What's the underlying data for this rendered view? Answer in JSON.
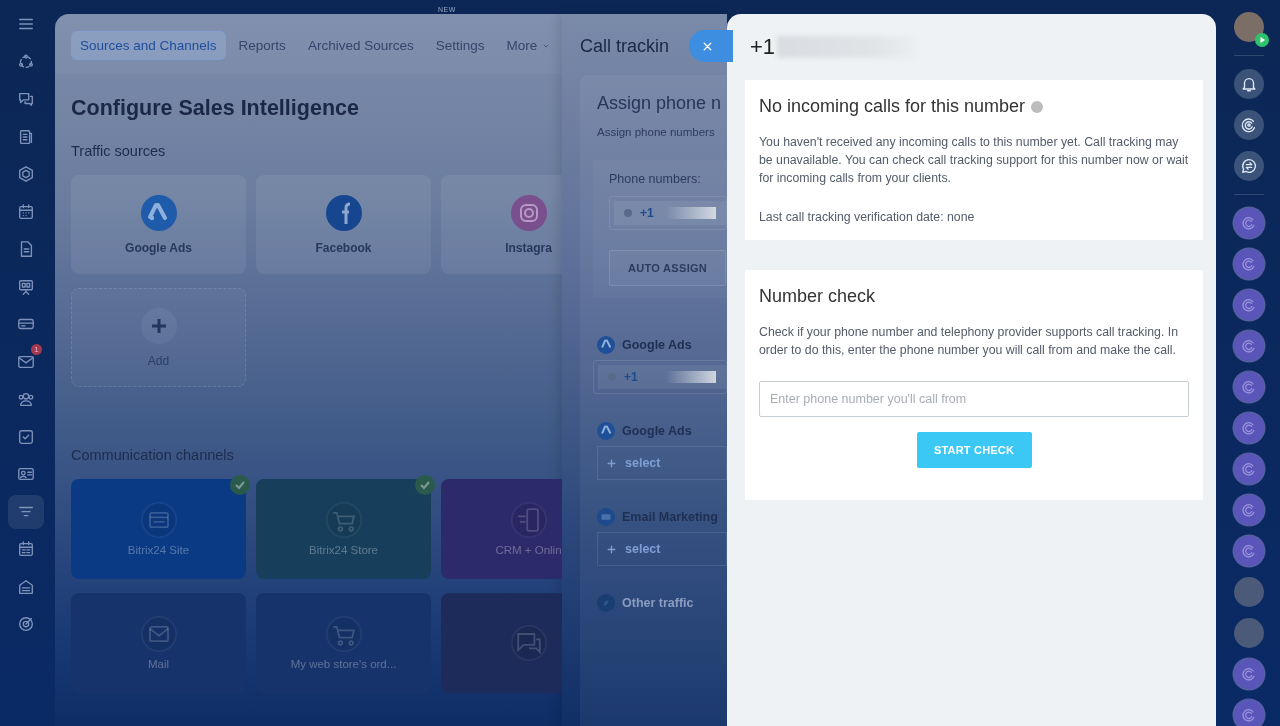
{
  "top_badge": "NEW",
  "left_bar": {
    "items": [
      {
        "kind": "menu",
        "selected": false
      },
      {
        "kind": "dotted-circle",
        "selected": false
      },
      {
        "kind": "chat",
        "selected": false
      },
      {
        "kind": "news",
        "selected": false
      },
      {
        "kind": "hexagon",
        "selected": false
      },
      {
        "kind": "calendar",
        "selected": false
      },
      {
        "kind": "document",
        "selected": false
      },
      {
        "kind": "board",
        "selected": false
      },
      {
        "kind": "card",
        "selected": false
      },
      {
        "kind": "mail",
        "selected": false,
        "badge": "1"
      },
      {
        "kind": "people",
        "selected": false
      },
      {
        "kind": "task",
        "selected": false
      },
      {
        "kind": "contact",
        "selected": false
      },
      {
        "kind": "funnel",
        "selected": true
      },
      {
        "kind": "calendar-list",
        "selected": false
      },
      {
        "kind": "building",
        "selected": false
      },
      {
        "kind": "target",
        "selected": false
      }
    ]
  },
  "config_page": {
    "tabs": [
      {
        "label": "Sources and Channels",
        "selected": true
      },
      {
        "label": "Reports",
        "selected": false
      },
      {
        "label": "Archived Sources",
        "selected": false
      },
      {
        "label": "Settings",
        "selected": false
      },
      {
        "label": "More",
        "selected": false
      }
    ],
    "title": "Configure Sales Intelligence",
    "traffic_sources_heading": "Traffic sources",
    "traffic_sources": [
      {
        "kind": "google-ads",
        "label": "Google Ads"
      },
      {
        "kind": "facebook",
        "label": "Facebook"
      },
      {
        "kind": "instagram",
        "label": "Instagra"
      },
      {
        "kind": "add",
        "label": "Add"
      }
    ],
    "channels_heading": "Communication channels",
    "channels": [
      {
        "kind": "site",
        "label": "Bitrix24 Site",
        "color": "#0b3a84",
        "checked": true
      },
      {
        "kind": "store",
        "label": "Bitrix24 Store",
        "color": "#173f5c",
        "checked": true
      },
      {
        "kind": "crm",
        "label": "CRM + Onlin",
        "color": "#2c2a6a",
        "checked": false
      },
      {
        "kind": "mail",
        "label": "Mail",
        "color": "#16336b",
        "checked": false
      },
      {
        "kind": "cart",
        "label": "My web store's ord...",
        "color": "#16336b",
        "checked": false
      },
      {
        "kind": "chat",
        "color": "#1d2b5a",
        "checked": false
      }
    ]
  },
  "call_tracking": {
    "title": "Call trackin",
    "section_title": "Assign phone n",
    "section_subtitle": "Assign phone numbers",
    "phone_numbers_label": "Phone numbers:",
    "phone_numbers": [
      "+1"
    ],
    "auto_assign": "AUTO ASSIGN",
    "sources": [
      {
        "kind": "google-ads",
        "label": "Google Ads",
        "number": "+1"
      },
      {
        "kind": "google-ads",
        "label": "Google Ads",
        "select": "select"
      },
      {
        "kind": "email",
        "label": "Email Marketing",
        "select": "select"
      },
      {
        "kind": "other",
        "label": "Other traffic"
      }
    ]
  },
  "number_panel": {
    "number": "+1",
    "status": {
      "title": "No incoming calls for this number",
      "verified": false,
      "description": "You haven't received any incoming calls to this number yet. Call tracking may be unavailable. You can check call tracking support for this number now or wait for incoming calls from your clients.",
      "last_check": "Last call tracking verification date: none"
    },
    "check": {
      "title": "Number check",
      "description": "Check if your phone number and telephony provider supports call tracking. In order to do this, enter the phone number you will call from and make the call.",
      "placeholder": "Enter phone number you'll call from",
      "button": "START CHECK"
    }
  },
  "right_bar": {
    "items": [
      {
        "kind": "user"
      },
      {
        "kind": "bell"
      },
      {
        "kind": "swirl"
      },
      {
        "kind": "chat-swap"
      },
      {
        "kind": "channel"
      },
      {
        "kind": "channel"
      },
      {
        "kind": "channel"
      },
      {
        "kind": "channel"
      },
      {
        "kind": "channel"
      },
      {
        "kind": "channel"
      },
      {
        "kind": "channel"
      },
      {
        "kind": "channel"
      },
      {
        "kind": "channel"
      },
      {
        "kind": "photo"
      },
      {
        "kind": "photo"
      },
      {
        "kind": "channel"
      },
      {
        "kind": "channel"
      }
    ]
  }
}
